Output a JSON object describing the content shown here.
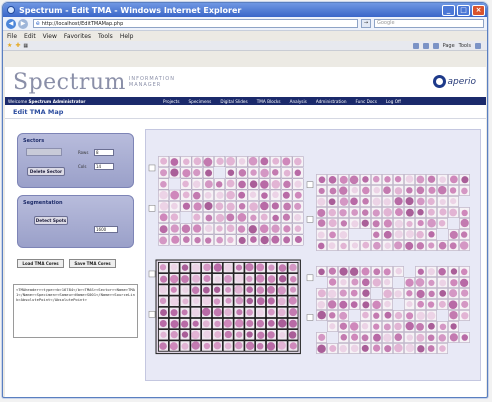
{
  "browser": {
    "title": "Spectrum - Edit TMA - Windows Internet Explorer",
    "address": "http://localhost/EditTMAMap.php",
    "search_placeholder": "Google",
    "menu": [
      "File",
      "Edit",
      "View",
      "Favorites",
      "Tools",
      "Help"
    ],
    "command_items": [
      "Page",
      "Tools"
    ]
  },
  "header": {
    "logo": "Spectrum",
    "logo_sub_line1": "INFORMATION",
    "logo_sub_line2": "MANAGER",
    "brand": "aperio"
  },
  "nav": {
    "welcome_prefix": "Welcome",
    "user": "Spectrum Administrator",
    "items": [
      "Projects",
      "Specimens",
      "Digital Slides",
      "TMA Blocks",
      "Analysis",
      "Administration",
      "Func Docs",
      "Log Off"
    ]
  },
  "page_title": "Edit TMA Map",
  "sectors": {
    "title": "Sectors",
    "delete_label": "Delete Sector",
    "row_label": "Rows",
    "row_value": "8",
    "col_label": "Cols",
    "col_value": "14"
  },
  "segmentation": {
    "title": "Segmentation",
    "button_label": "Detect Spots",
    "threshold_value": "1600"
  },
  "actions": {
    "load_label": "Load TMA Cores",
    "save_label": "Save TMA Cores"
  },
  "xml_text": "<TMAheader><type><b>16784</b><TMAS><Sector><Name>TMA1</Name><Specimen><Sameu><Name>S001</Name><SourceLink>AbsolutePoint</AbsolutePoint>",
  "colors": {
    "nav_bg": "#1b2a6b",
    "panel_bg": "#9aa0c9",
    "core_pink": "#c37ab0",
    "selected_border": "#111111"
  }
}
